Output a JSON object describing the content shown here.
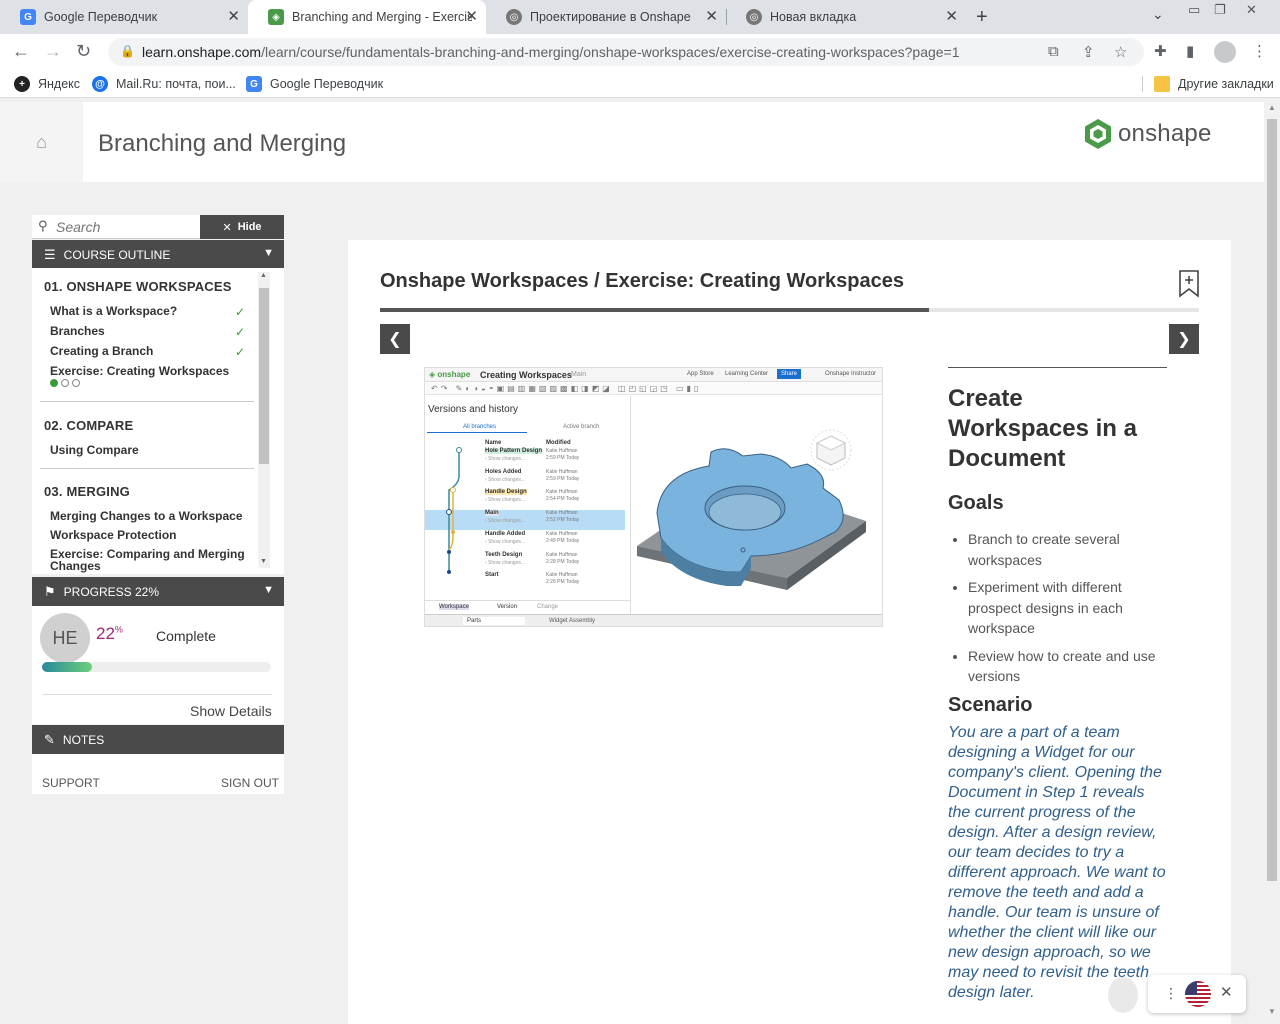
{
  "browser": {
    "tabs": [
      {
        "label": "Google Переводчик",
        "active": false
      },
      {
        "label": "Branching and Merging - Exercis",
        "active": true
      },
      {
        "label": "Проектирование в Onshape",
        "active": false
      },
      {
        "label": "Новая вкладка",
        "active": false
      }
    ],
    "url_host": "learn.onshape.com",
    "url_path": "/learn/course/fundamentals-branching-and-merging/onshape-workspaces/exercise-creating-workspaces?page=1",
    "bookmarks": [
      {
        "label": "Яндекс"
      },
      {
        "label": "Mail.Ru: почта, пои..."
      },
      {
        "label": "Google Переводчик"
      }
    ],
    "other_bookmarks": "Другие закладки"
  },
  "header": {
    "course_title": "Branching and Merging",
    "logo_text": "onshape",
    "brand_color": "#4a9a4a"
  },
  "sidebar": {
    "search_placeholder": "Search",
    "hide_label": "Hide",
    "outline_label": "COURSE OUTLINE",
    "sections": [
      {
        "title": "01. ONSHAPE WORKSPACES",
        "items": [
          {
            "label": "What is a Workspace?",
            "done": true
          },
          {
            "label": "Branches",
            "done": true
          },
          {
            "label": "Creating a Branch",
            "done": true
          },
          {
            "label": "Exercise: Creating Workspaces",
            "done": false
          }
        ]
      },
      {
        "title": "02. COMPARE",
        "items": [
          {
            "label": "Using Compare",
            "done": false
          }
        ]
      },
      {
        "title": "03. MERGING",
        "items": [
          {
            "label": "Merging Changes to a Workspace",
            "done": false
          },
          {
            "label": "Workspace Protection",
            "done": false
          },
          {
            "label": "Exercise: Comparing and Merging Changes",
            "done": false
          }
        ]
      }
    ],
    "progress_label": "PROGRESS 22%",
    "avatar_initials": "HE",
    "progress_value": 22,
    "progress_unit": "%",
    "complete_label": "Complete",
    "show_details": "Show Details",
    "notes_label": "NOTES",
    "support": "SUPPORT",
    "sign_out": "SIGN OUT"
  },
  "main": {
    "lesson_title": "Onshape Workspaces / Exercise: Creating Workspaces",
    "lesson_progress": 0.67,
    "screenshot": {
      "doc_title": "Creating Workspaces",
      "branch": "Main",
      "buttons": [
        "App Store",
        "Learning Center",
        "Share"
      ],
      "user": "Onshape Instructor",
      "panel_title": "Versions and history",
      "panel_tabs": [
        "All branches",
        "Active branch"
      ],
      "columns": [
        "Name",
        "Modified"
      ],
      "rows": [
        {
          "name": "Hole Pattern Design",
          "modified": "Katie Huffman",
          "time": "2:59 PM Today"
        },
        {
          "name": "Holes Added",
          "modified": "Katie Huffman",
          "time": "2:59 PM Today"
        },
        {
          "name": "Handle Design",
          "modified": "Katie Huffman",
          "time": "2:54 PM Today"
        },
        {
          "name": "Main",
          "modified": "Katie Huffman",
          "time": "2:52 PM Today"
        },
        {
          "name": "Handle Added",
          "modified": "Katie Huffman",
          "time": "2:49 PM Today"
        },
        {
          "name": "Teeth Design",
          "modified": "Katie Huffman",
          "time": "2:28 PM Today"
        },
        {
          "name": "Start",
          "modified": "Katie Huffman",
          "time": "2:26 PM Today"
        }
      ],
      "show_changes": "Show changes...",
      "footer_items": [
        "Workspace",
        "Version",
        "Change"
      ],
      "bottom_tabs": [
        "Parts",
        "Widget Assembly"
      ]
    },
    "heading": "Create Workspaces in a Document",
    "goals_title": "Goals",
    "goals": [
      "Branch to create several workspaces",
      "Experiment with different prospect designs in each workspace",
      "Review how to create and use versions"
    ],
    "scenario_title": "Scenario",
    "scenario_text": "You are a part of a team designing a Widget for our company's client. Opening the Document in Step 1 reveals the current progress of the design. After a design review, our team decides to try a different approach. We want to remove the teeth and add a handle. Our team is unsure of whether the client will like our new design approach, so we may need to revisit the teeth design later."
  }
}
